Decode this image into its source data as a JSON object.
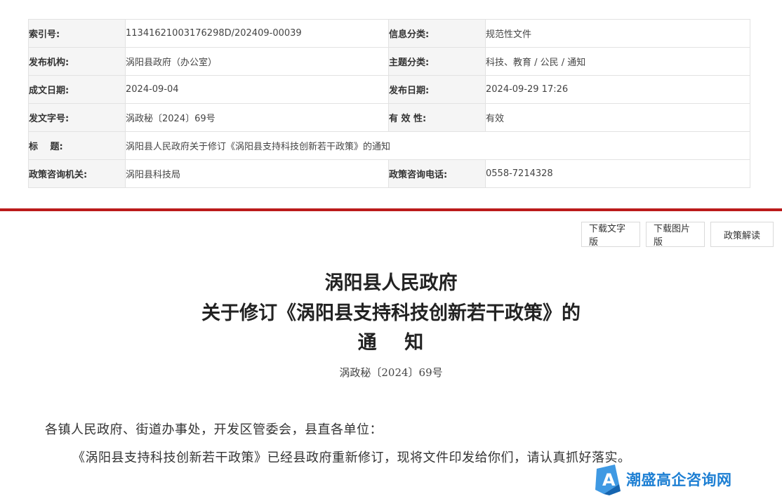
{
  "meta": {
    "rows": [
      {
        "k1": "索引号:",
        "v1": "11341621003176298D/202409-00039",
        "k2": "信息分类:",
        "v2": "规范性文件"
      },
      {
        "k1": "发布机构:",
        "v1": "涡阳县政府（办公室）",
        "k2": "主题分类:",
        "v2": "科技、教育 / 公民 / 通知"
      },
      {
        "k1": "成文日期:",
        "v1": "2024-09-04",
        "k2": "发布日期:",
        "v2": "2024-09-29 17:26"
      },
      {
        "k1": "发文字号:",
        "v1": "涡政秘〔2024〕69号",
        "k2": "有 效 性:",
        "v2": "有效"
      },
      {
        "k1": "标　 题:",
        "v1": "涡阳县人民政府关于修订《涡阳县支持科技创新若干政策》的通知"
      },
      {
        "k1": "政策咨询机关:",
        "v1": "涡阳县科技局",
        "k2": "政策咨询电话:",
        "v2": "0558-7214328"
      }
    ]
  },
  "buttons": {
    "download_text": "下载文字版",
    "download_image": "下载图片版",
    "policy_interpretation": "政策解读"
  },
  "document": {
    "title_line1": "涡阳县人民政府",
    "title_line2": "关于修订《涡阳县支持科技创新若干政策》的",
    "title_line3": "通　 知",
    "doc_number": "涡政秘〔2024〕69号",
    "salutation": "各镇人民政府、街道办事处，开发区管委会，县直各单位：",
    "body": "《涡阳县支持科技创新若干政策》已经县政府重新修订，现将文件印发给你们，请认真抓好落实。"
  },
  "watermark": {
    "text": "潮盛高企咨询网"
  },
  "colors": {
    "accent_red": "#bb1b1b",
    "watermark_blue": "#1d7fd3"
  }
}
